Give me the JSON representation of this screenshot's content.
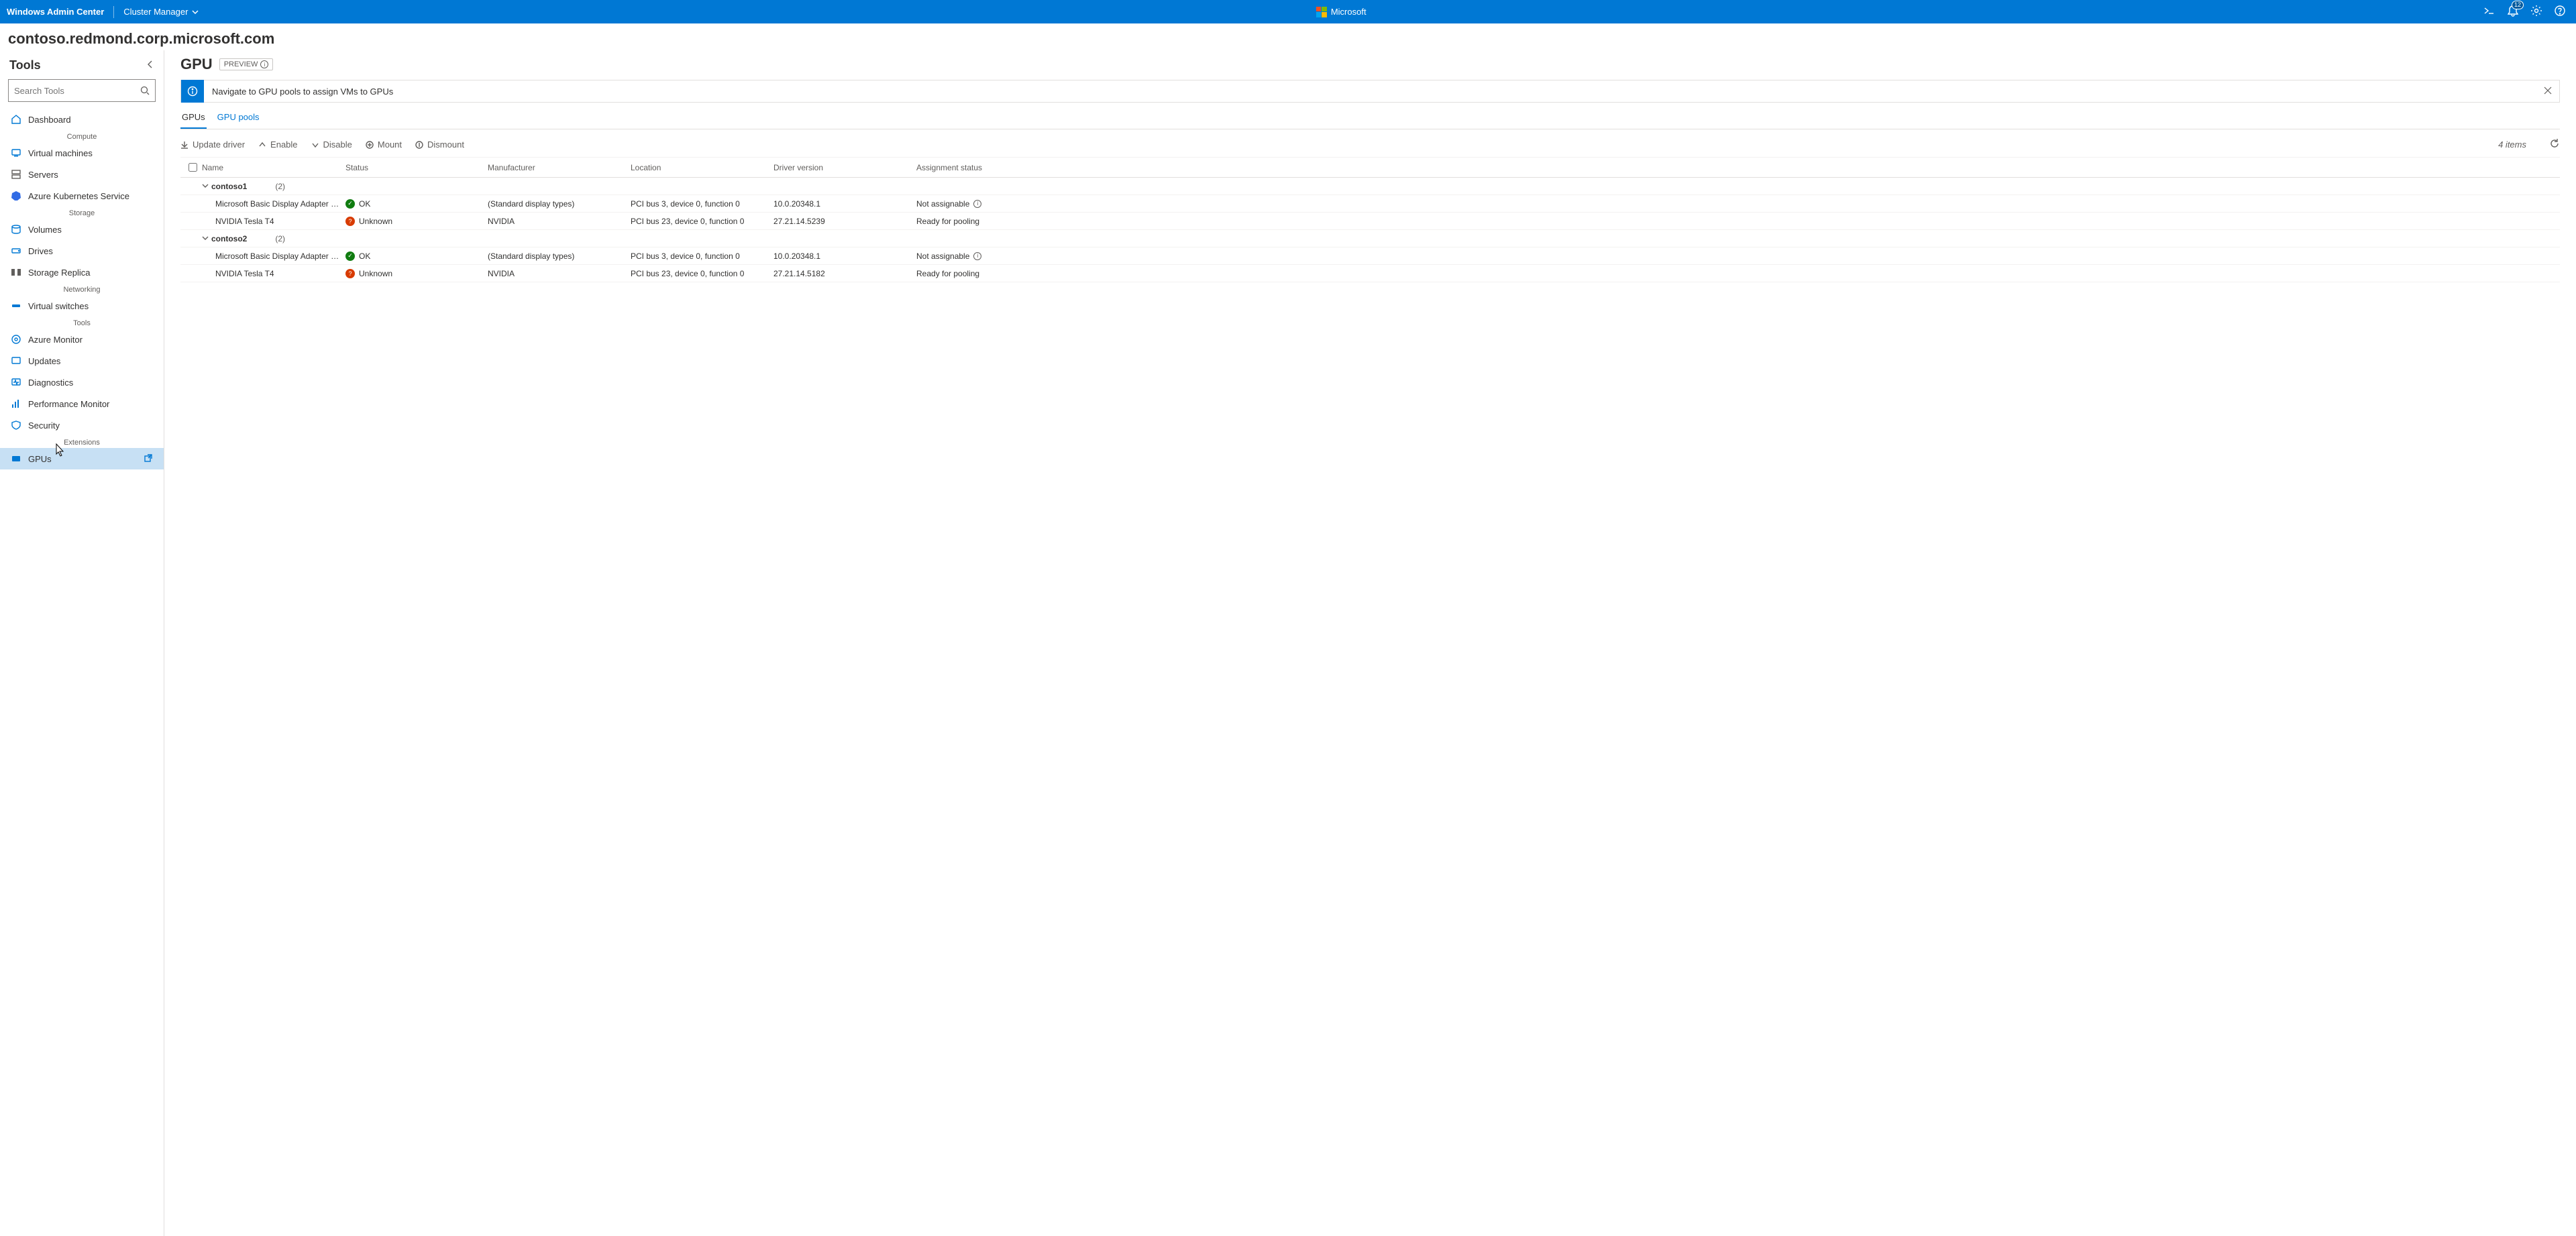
{
  "topbar": {
    "app_name": "Windows Admin Center",
    "module": "Cluster Manager",
    "brand": "Microsoft",
    "notif_count": "12"
  },
  "host": "contoso.redmond.corp.microsoft.com",
  "sidebar": {
    "title": "Tools",
    "search_placeholder": "Search Tools",
    "items": {
      "dashboard": {
        "label": "Dashboard"
      },
      "g_compute": "Compute",
      "vms": {
        "label": "Virtual machines"
      },
      "servers": {
        "label": "Servers"
      },
      "aks": {
        "label": "Azure Kubernetes Service"
      },
      "g_storage": "Storage",
      "volumes": {
        "label": "Volumes"
      },
      "drives": {
        "label": "Drives"
      },
      "storage_replica": {
        "label": "Storage Replica"
      },
      "g_networking": "Networking",
      "vswitches": {
        "label": "Virtual switches"
      },
      "g_tools": "Tools",
      "azure_monitor": {
        "label": "Azure Monitor"
      },
      "updates": {
        "label": "Updates"
      },
      "diagnostics": {
        "label": "Diagnostics"
      },
      "perfmon": {
        "label": "Performance Monitor"
      },
      "security": {
        "label": "Security"
      },
      "g_extensions": "Extensions",
      "gpus": {
        "label": "GPUs"
      }
    }
  },
  "page": {
    "title": "GPU",
    "preview_badge": "PREVIEW",
    "banner_text": "Navigate to GPU pools to assign VMs to GPUs",
    "tabs": {
      "gpus": "GPUs",
      "gpu_pools": "GPU pools"
    },
    "toolbar": {
      "update_driver": "Update driver",
      "enable": "Enable",
      "disable": "Disable",
      "mount": "Mount",
      "dismount": "Dismount",
      "items_count": "4 items"
    }
  },
  "table": {
    "columns": {
      "name": "Name",
      "status": "Status",
      "manufacturer": "Manufacturer",
      "location": "Location",
      "driver_version": "Driver version",
      "assignment_status": "Assignment status"
    },
    "groups": [
      {
        "name": "contoso1",
        "count": "(2)",
        "rows": [
          {
            "name": "Microsoft Basic Display Adapter (Low Resolu...",
            "status": "OK",
            "status_kind": "ok",
            "manufacturer": "(Standard display types)",
            "location": "PCI bus 3, device 0, function 0",
            "driver_version": "10.0.20348.1",
            "assignment_status": "Not assignable",
            "assign_info": true
          },
          {
            "name": "NVIDIA Tesla T4",
            "status": "Unknown",
            "status_kind": "unknown",
            "manufacturer": "NVIDIA",
            "location": "PCI bus 23, device 0, function 0",
            "driver_version": "27.21.14.5239",
            "assignment_status": "Ready for pooling",
            "assign_info": false
          }
        ]
      },
      {
        "name": "contoso2",
        "count": "(2)",
        "rows": [
          {
            "name": "Microsoft Basic Display Adapter (Low Resolu...",
            "status": "OK",
            "status_kind": "ok",
            "manufacturer": "(Standard display types)",
            "location": "PCI bus 3, device 0, function 0",
            "driver_version": "10.0.20348.1",
            "assignment_status": "Not assignable",
            "assign_info": true
          },
          {
            "name": "NVIDIA Tesla T4",
            "status": "Unknown",
            "status_kind": "unknown",
            "manufacturer": "NVIDIA",
            "location": "PCI bus 23, device 0, function 0",
            "driver_version": "27.21.14.5182",
            "assignment_status": "Ready for pooling",
            "assign_info": false
          }
        ]
      }
    ]
  }
}
